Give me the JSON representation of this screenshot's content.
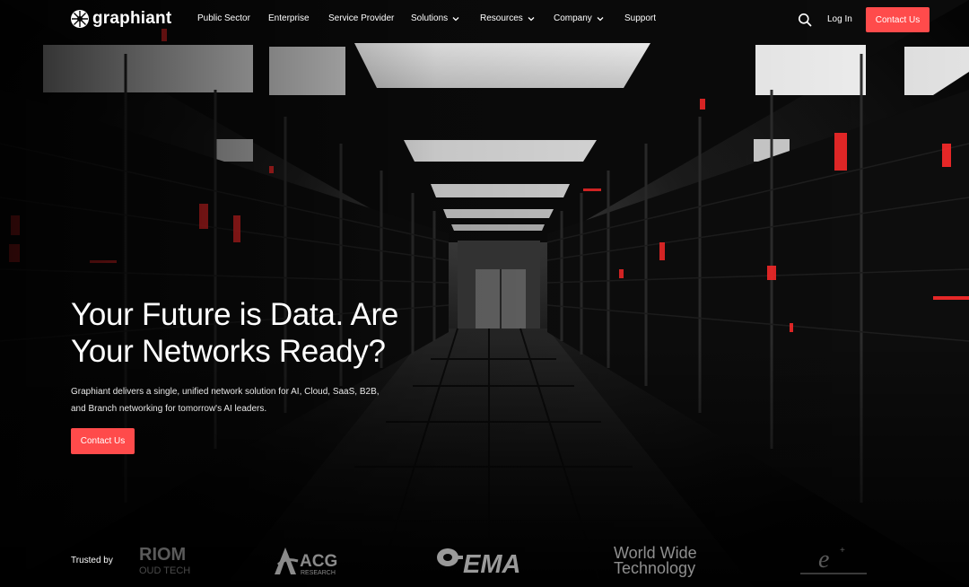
{
  "brand": {
    "name": "graphiant",
    "accent": "#ff4b4b"
  },
  "nav": {
    "items": [
      {
        "label": "Public Sector",
        "dropdown": false
      },
      {
        "label": "Enterprise",
        "dropdown": false
      },
      {
        "label": "Service Provider",
        "dropdown": false
      },
      {
        "label": "Solutions",
        "dropdown": true
      },
      {
        "label": "Resources",
        "dropdown": true
      },
      {
        "label": "Company",
        "dropdown": true
      },
      {
        "label": "Support",
        "dropdown": false
      }
    ],
    "search_icon": "search-icon",
    "login_label": "Log In",
    "contact_label": "Contact Us"
  },
  "hero": {
    "title_line1": "Your Future is Data. Are",
    "title_line2": "Your Networks Ready?",
    "subtitle_line1": "Graphiant delivers a single, unified network solution for AI, Cloud, SaaS, B2B,",
    "subtitle_line2": "and Branch networking for tomorrow's AI leaders.",
    "cta_label": "Contact Us"
  },
  "trusted": {
    "label": "Trusted by",
    "logos": [
      {
        "name": "riom-cloud-tech-logo",
        "text_top": "RIOM",
        "text_bottom": "OUD TECH"
      },
      {
        "name": "acg-research-logo",
        "text_top": "ACG",
        "text_bottom": "RESEARCH"
      },
      {
        "name": "ema-logo",
        "text_top": "EMA"
      },
      {
        "name": "world-wide-technology-logo",
        "text_top": "World Wide",
        "text_bottom": "Technology"
      },
      {
        "name": "e-plus-logo",
        "text_top": "e"
      }
    ]
  }
}
